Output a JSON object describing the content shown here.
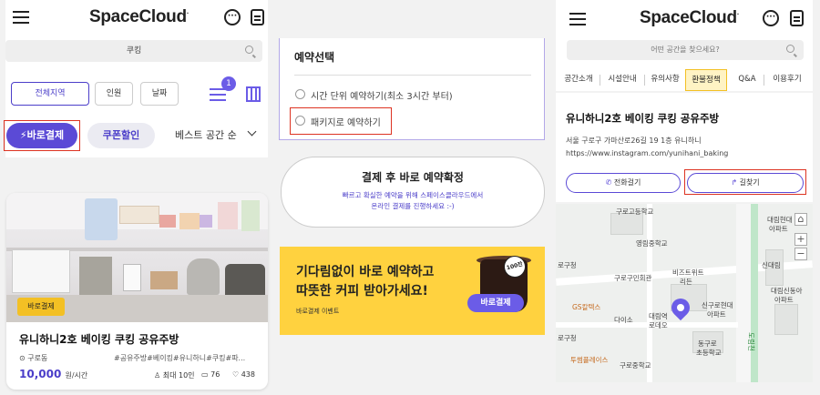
{
  "app": {
    "logo": "SpaceCloud",
    "logo_mark": "."
  },
  "left": {
    "search_value": "쿠킹",
    "filters": {
      "region": "전체지역",
      "people": "인원",
      "date": "날짜",
      "filter_count": "1"
    },
    "pay_button": "⚡바로결제",
    "coupon_button": "쿠폰할인",
    "sort": "베스트 공간 순",
    "card": {
      "badge": "바로결제",
      "title": "유니하니2호 베이킹 쿠킹 공유주방",
      "location": "구로동",
      "tags": "#공유주방#베이킹#유니하니#쿠킹#파...",
      "price": "10,000",
      "price_unit": "원/시간",
      "capacity": "최대 10인",
      "comments": "76",
      "likes": "438"
    }
  },
  "middle": {
    "section_title": "예약선택",
    "options": [
      "시간 단위 예약하기(최소 3시간 부터)",
      "패키지로 예약하기"
    ],
    "confirm_title": "결제 후 바로 예약확정",
    "confirm_line1": "빠르고 확실한 예약을 위해 스페이스클라우드에서",
    "confirm_line2": "온라인 결제를 진행하세요 :-)",
    "banner_line1": "기다림없이 바로 예약하고",
    "banner_line2": "따뜻한 커피 받아가세요!",
    "banner_sub": "바로결제 이벤트",
    "banner_pill": "바로결제",
    "banner_sticker": "100잔"
  },
  "right": {
    "search_placeholder": "어떤 공간을 찾으세요?",
    "tabs": [
      "공간소개",
      "시설안내",
      "유의사항",
      "환불정책",
      "Q&A",
      "이용후기"
    ],
    "active_tab": "환불정책",
    "title": "유니하니2호 베이킹 쿠킹 공유주방",
    "address": "서울 구로구 가마산로26길 19 1층 유니하니",
    "url": "https://www.instagram.com/yunihani_baking",
    "call_button": "전화걸기",
    "directions_button": "길찾기",
    "map_labels": {
      "l1": "구로고등학교",
      "l2": "영림중학교",
      "l3": "구로구민회관",
      "l4": "비즈트위트",
      "l4b": "리든",
      "l5": "GS칼텍스",
      "l6": "다이소",
      "l7": "대림역",
      "l7b": "로데오",
      "l8": "신구로현대",
      "l8b": "아파트",
      "l9": "대림현대",
      "l9b": "아파트",
      "l10": "동구로",
      "l10b": "초등학교",
      "l11": "구로중학교",
      "l12": "투썸플레이스",
      "l13": "대림신동아",
      "l13b": "아파트",
      "l14": "로구청",
      "l15": "로구청",
      "l16": "신대림",
      "l17": "도림천"
    }
  },
  "colors": {
    "accent": "#5b4ad6",
    "highlight": "#d32",
    "banner": "#ffd23f"
  }
}
